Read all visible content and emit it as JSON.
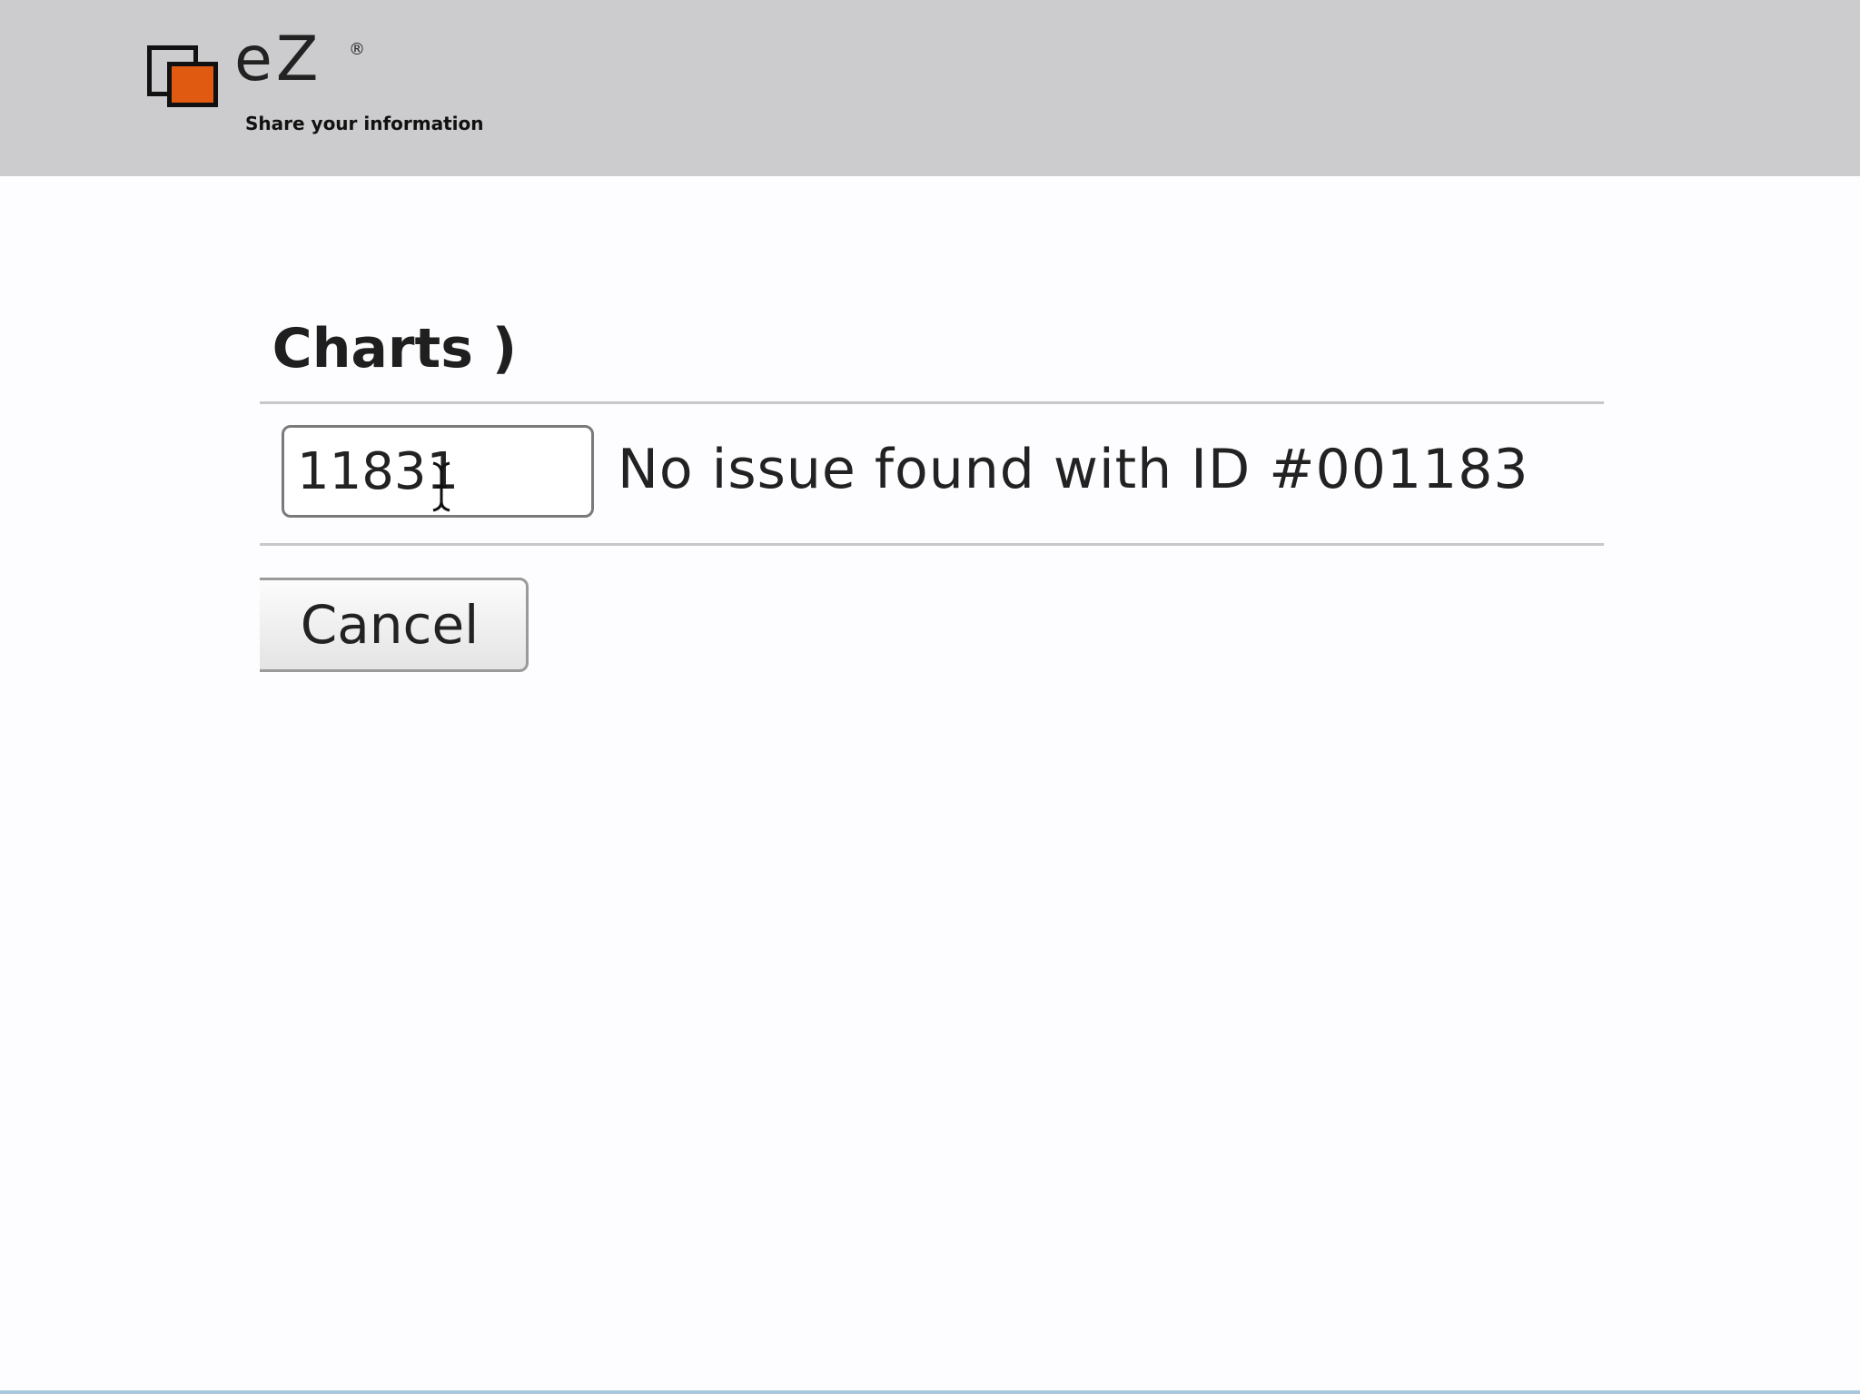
{
  "header": {
    "logo": {
      "word": "eZ",
      "registered_mark": "®",
      "tagline": "Share your information",
      "accent_color": "#e05a12"
    },
    "background_color": "#cccbcd"
  },
  "main": {
    "title": "· Charts )",
    "issue_form": {
      "id_input_value": "11831",
      "status_message": "No issue found with ID #001183",
      "cancel_label": "Cancel"
    }
  },
  "icons": {
    "logo": "ez-logo-icon",
    "cursor": "text-cursor-icon"
  }
}
